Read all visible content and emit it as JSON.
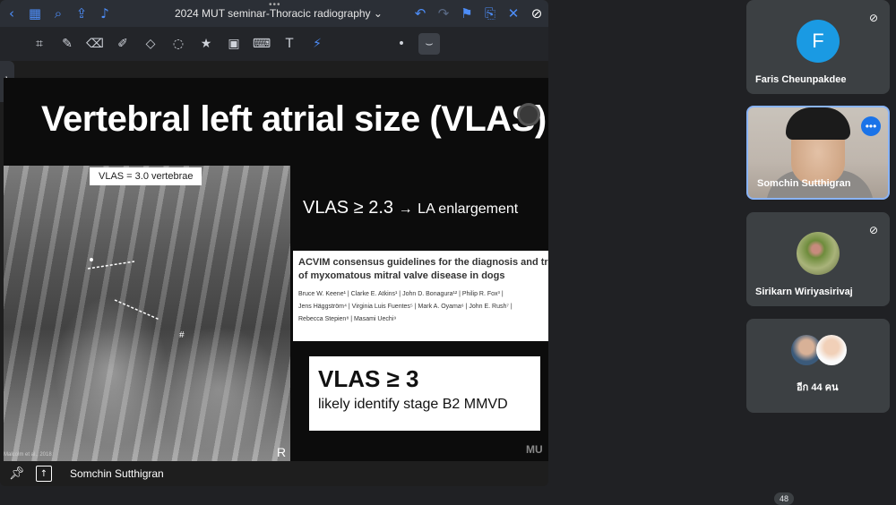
{
  "share": {
    "doc_title": "2024 MUT seminar-Thoracic radiography",
    "title_chevron": "⌄",
    "top_icons": {
      "back": "back-icon",
      "grid": "grid-icon",
      "search": "search-icon",
      "share": "share-icon",
      "mic": "mic-icon",
      "undo": "undo-icon",
      "redo": "redo-icon",
      "bookmark": "bookmark-icon",
      "export": "export-icon",
      "close": "close-icon"
    },
    "tools": [
      "image-select-icon",
      "pen-icon",
      "eraser-icon",
      "highlighter-icon",
      "shapes-icon",
      "lasso-icon",
      "sticker-icon",
      "image-icon",
      "keyboard-icon",
      "textbox-icon",
      "laser-icon"
    ],
    "side_tab": "⟩"
  },
  "slide": {
    "title": "Vertebral left atrial size (VLAS)",
    "xray_label": "VLAS = 3.0 vertebrae",
    "xray_marker": "#",
    "xray_side": "R",
    "xray_citation": "Malcolm et al., 2018",
    "rule_main": "VLAS ≥ 2.3",
    "rule_arrow": "→",
    "rule_result": "LA enlargement",
    "paper_title_line1": "ACVIM consensus guidelines for the diagnosis and treatmer",
    "paper_title_line2": "of myxomatous mitral valve disease in dogs",
    "paper_authors_line1": "Bruce W. Keene¹  |  Clarke E. Atkins¹  |  John D. Bonagura¹²  |  Philip R. Fox³  |",
    "paper_authors_line2": "Jens Häggström⁴  |  Virginia Luis Fuentes⁵  |  Mark A. Oyama⁶  |  John E. Rush⁷  |",
    "paper_authors_line3": "Rebecca Stepien⁸  |  Masami Uechi⁹",
    "box_main": "VLAS ≥ 3",
    "box_sub": "likely identify stage B2 MMVD",
    "logo": "MU"
  },
  "bottom_bar": {
    "pin": "pin-icon",
    "popout": "popout-icon",
    "presenter": "Somchin Sutthigran"
  },
  "participants": [
    {
      "name": "Faris Cheunpakdee",
      "initial": "F",
      "avatar_color": "#1a9ae3",
      "muted": true
    },
    {
      "name": "Somchin Sutthigran",
      "video": true,
      "muted": true
    },
    {
      "name": "Sirikarn Wiriyasirivaj",
      "muted": true
    },
    {
      "name": "อีก 44 คน"
    }
  ],
  "people_count": "48"
}
